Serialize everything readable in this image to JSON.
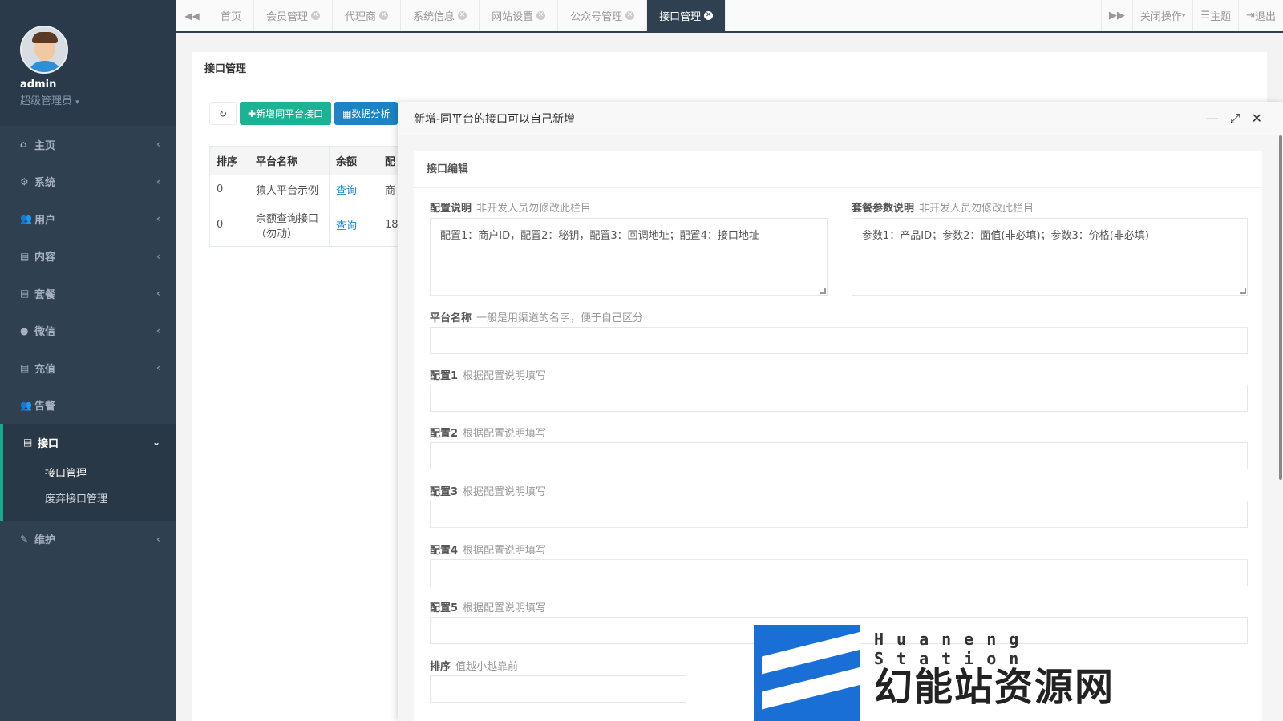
{
  "user": {
    "name": "admin",
    "role": "超级管理员"
  },
  "sidebar": {
    "items": [
      {
        "label": "主页",
        "icon": "home-icon"
      },
      {
        "label": "系统",
        "icon": "cogs-icon"
      },
      {
        "label": "用户",
        "icon": "users-icon"
      },
      {
        "label": "内容",
        "icon": "file-icon"
      },
      {
        "label": "套餐",
        "icon": "file-text-icon"
      },
      {
        "label": "微信",
        "icon": "wechat-icon"
      },
      {
        "label": "充值",
        "icon": "file-text-icon"
      },
      {
        "label": "告警",
        "icon": "users-icon"
      }
    ],
    "active": {
      "label": "接口",
      "icon": "file-icon",
      "children": [
        "接口管理",
        "废弃接口管理"
      ]
    },
    "after": [
      {
        "label": "维护",
        "icon": "wrench-icon"
      }
    ]
  },
  "tabs": [
    {
      "label": "首页",
      "closable": false
    },
    {
      "label": "会员管理",
      "closable": true
    },
    {
      "label": "代理商",
      "closable": true
    },
    {
      "label": "系统信息",
      "closable": true
    },
    {
      "label": "网站设置",
      "closable": true
    },
    {
      "label": "公众号管理",
      "closable": true
    },
    {
      "label": "接口管理",
      "closable": true,
      "active": true
    }
  ],
  "topbar": {
    "close_ops": "关闭操作",
    "theme": "主题",
    "logout": "退出"
  },
  "panel": {
    "title": "接口管理",
    "buttons": {
      "add": "新增同平台接口",
      "stats": "数据分析"
    },
    "table": {
      "headers": [
        "排序",
        "平台名称",
        "余额",
        "配"
      ],
      "rows": [
        {
          "sort": "0",
          "name": "猿人平台示例",
          "balance": "查询",
          "cfg": "商"
        },
        {
          "sort": "0",
          "name": "余额查询接口（勿动）",
          "balance": "查询",
          "cfg": "18"
        }
      ]
    }
  },
  "modal": {
    "title": "新增-同平台的接口可以自己新增",
    "section": "接口编辑",
    "config_desc": {
      "label": "配置说明",
      "hint": "非开发人员勿修改此栏目",
      "value": "配置1：商户ID，配置2：秘钥，配置3：回调地址；配置4：接口地址"
    },
    "param_desc": {
      "label": "套餐参数说明",
      "hint": "非开发人员勿修改此栏目",
      "value": "参数1：产品ID；参数2：面值(非必填)；参数3：价格(非必填)"
    },
    "platform_name": {
      "label": "平台名称",
      "hint": "一般是用渠道的名字，便于自己区分",
      "value": ""
    },
    "config1": {
      "label": "配置1",
      "hint": "根据配置说明填写",
      "value": ""
    },
    "config2": {
      "label": "配置2",
      "hint": "根据配置说明填写",
      "value": ""
    },
    "config3": {
      "label": "配置3",
      "hint": "根据配置说明填写",
      "value": ""
    },
    "config4": {
      "label": "配置4",
      "hint": "根据配置说明填写",
      "value": ""
    },
    "config5": {
      "label": "配置5",
      "hint": "根据配置说明填写",
      "value": ""
    },
    "sort": {
      "label": "排序",
      "hint": "值越小越靠前",
      "value": ""
    }
  },
  "watermark": {
    "en": "Huaneng Station",
    "cn": "幻能站资源网"
  }
}
